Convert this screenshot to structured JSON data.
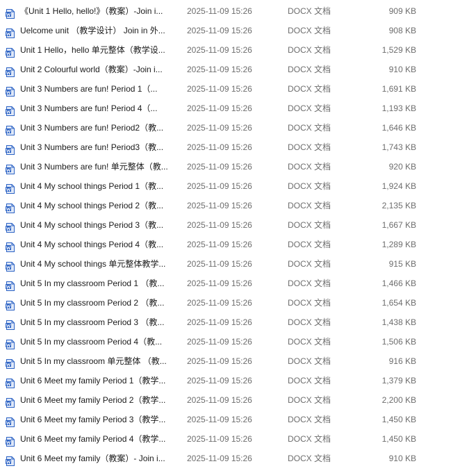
{
  "colors": {
    "icon_blue": "#2b62c4",
    "icon_light": "#dfe8f8",
    "secondary_text": "#6d6d6d"
  },
  "icons": {
    "file_icon": "word-document-icon"
  },
  "files": [
    {
      "name": "《Unit 1 Hello, hello!》（教案）-Join i...",
      "date": "2025-11-09 15:26",
      "type": "DOCX 文档",
      "size": "909 KB"
    },
    {
      "name": "Uelcome unit （教学设计） Join in 外...",
      "date": "2025-11-09 15:26",
      "type": "DOCX 文档",
      "size": "908 KB"
    },
    {
      "name": "Unit 1 Hello，hello 单元整体（教学设...",
      "date": "2025-11-09 15:26",
      "type": "DOCX 文档",
      "size": "1,529 KB"
    },
    {
      "name": "Unit 2 Colourful world（教案）-Join i...",
      "date": "2025-11-09 15:26",
      "type": "DOCX 文档",
      "size": "910 KB"
    },
    {
      "name": "Unit 3 Numbers are fun! Period 1（...",
      "date": "2025-11-09 15:26",
      "type": "DOCX 文档",
      "size": "1,691 KB"
    },
    {
      "name": "Unit 3 Numbers are fun! Period 4（...",
      "date": "2025-11-09 15:26",
      "type": "DOCX 文档",
      "size": "1,193 KB"
    },
    {
      "name": "Unit 3 Numbers are fun! Period2（教...",
      "date": "2025-11-09 15:26",
      "type": "DOCX 文档",
      "size": "1,646 KB"
    },
    {
      "name": "Unit 3 Numbers are fun! Period3（教...",
      "date": "2025-11-09 15:26",
      "type": "DOCX 文档",
      "size": "1,743 KB"
    },
    {
      "name": "Unit 3 Numbers are fun! 单元整体（教...",
      "date": "2025-11-09 15:26",
      "type": "DOCX 文档",
      "size": "920 KB"
    },
    {
      "name": "Unit 4 My school things Period 1（教...",
      "date": "2025-11-09 15:26",
      "type": "DOCX 文档",
      "size": "1,924 KB"
    },
    {
      "name": "Unit 4 My school things Period 2（教...",
      "date": "2025-11-09 15:26",
      "type": "DOCX 文档",
      "size": "2,135 KB"
    },
    {
      "name": "Unit 4 My school things Period 3（教...",
      "date": "2025-11-09 15:26",
      "type": "DOCX 文档",
      "size": "1,667 KB"
    },
    {
      "name": "Unit 4 My school things Period 4（教...",
      "date": "2025-11-09 15:26",
      "type": "DOCX 文档",
      "size": "1,289 KB"
    },
    {
      "name": "Unit 4 My school things 单元整体教学...",
      "date": "2025-11-09 15:26",
      "type": "DOCX 文档",
      "size": "915 KB"
    },
    {
      "name": "Unit 5 In my classroom Period 1 （教...",
      "date": "2025-11-09 15:26",
      "type": "DOCX 文档",
      "size": "1,466 KB"
    },
    {
      "name": "Unit 5 In my classroom Period 2 （教...",
      "date": "2025-11-09 15:26",
      "type": "DOCX 文档",
      "size": "1,654 KB"
    },
    {
      "name": "Unit 5 In my classroom Period 3 （教...",
      "date": "2025-11-09 15:26",
      "type": "DOCX 文档",
      "size": "1,438 KB"
    },
    {
      "name": "Unit 5 In my classroom Period 4（教...",
      "date": "2025-11-09 15:26",
      "type": "DOCX 文档",
      "size": "1,506 KB"
    },
    {
      "name": "Unit 5 In my classroom 单元整体 （教...",
      "date": "2025-11-09 15:26",
      "type": "DOCX 文档",
      "size": "916 KB"
    },
    {
      "name": "Unit 6 Meet my family Period 1（教学...",
      "date": "2025-11-09 15:26",
      "type": "DOCX 文档",
      "size": "1,379 KB"
    },
    {
      "name": "Unit 6 Meet my family Period 2（教学...",
      "date": "2025-11-09 15:26",
      "type": "DOCX 文档",
      "size": "2,200 KB"
    },
    {
      "name": "Unit 6 Meet my family Period 3（教学...",
      "date": "2025-11-09 15:26",
      "type": "DOCX 文档",
      "size": "1,450 KB"
    },
    {
      "name": "Unit 6 Meet my family Period 4（教学...",
      "date": "2025-11-09 15:26",
      "type": "DOCX 文档",
      "size": "1,450 KB"
    },
    {
      "name": "Unit 6 Meet my family（教案）- Join i...",
      "date": "2025-11-09 15:26",
      "type": "DOCX 文档",
      "size": "910 KB"
    }
  ]
}
